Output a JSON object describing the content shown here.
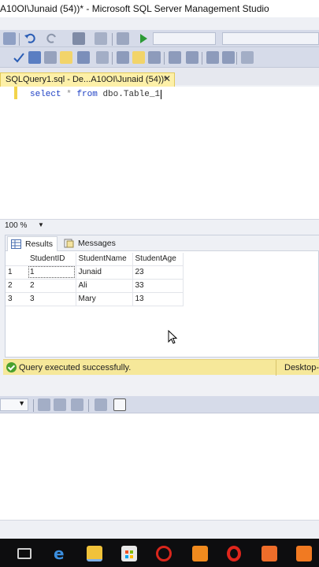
{
  "window": {
    "title": "A10OI\\Junaid (54))* - Microsoft SQL Server Management Studio"
  },
  "editor_tab": {
    "label": "SQLQuery1.sql - De...A10OI\\Junaid (54))*",
    "close_glyph": "✕"
  },
  "query": {
    "kw_select": "select",
    "star": "*",
    "kw_from": "from",
    "table": "dbo.Table_1"
  },
  "zoom": {
    "value": "100 %"
  },
  "result_tabs": [
    {
      "label": "Results"
    },
    {
      "label": "Messages"
    }
  ],
  "grid": {
    "columns": [
      "StudentID",
      "StudentName",
      "StudentAge"
    ],
    "rows": [
      {
        "n": "1",
        "id": "1",
        "name": "Junaid",
        "age": "23"
      },
      {
        "n": "2",
        "id": "2",
        "name": "Ali",
        "age": "33"
      },
      {
        "n": "3",
        "id": "3",
        "name": "Mary",
        "age": "13"
      }
    ]
  },
  "status": {
    "message": "Query executed successfully.",
    "server": "Desktop-I"
  },
  "colors": {
    "status_bg": "#f6e89a",
    "tab_active": "#fdf0a8",
    "toolbar": "#d6dbe9",
    "taskbar": "#0d0d0f"
  },
  "icons": {
    "toolbar": [
      "cut-icon",
      "undo-icon",
      "redo-icon",
      "new-window-icon",
      "debug-icon",
      "execute-icon",
      "check-icon",
      "parse-icon",
      "results-to-grid-icon",
      "comment-icon",
      "indent-icon"
    ],
    "taskbar": [
      "task-view-icon",
      "edge-icon",
      "file-explorer-icon",
      "store-icon",
      "chrome-like-icon",
      "sublime-icon",
      "opera-icon",
      "app-icon",
      "xampp-icon"
    ]
  }
}
